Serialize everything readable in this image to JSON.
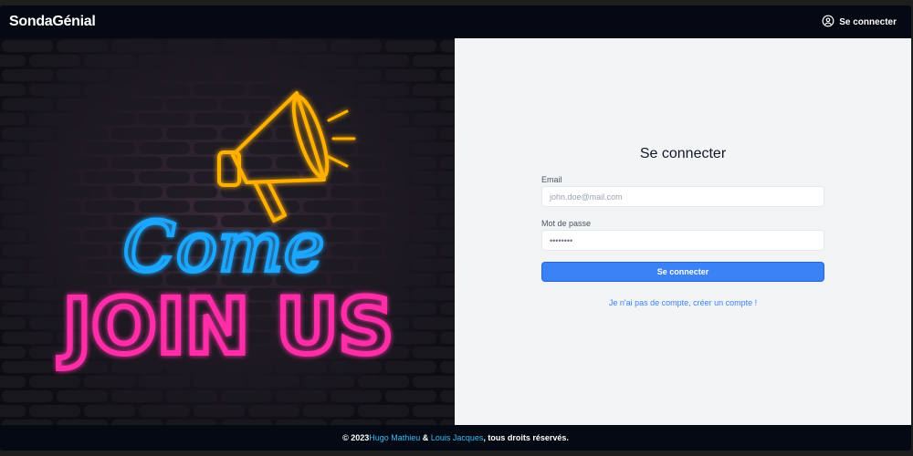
{
  "navbar": {
    "brand": "SondaGénial",
    "login_label": "Se connecter"
  },
  "hero": {
    "line1": "Come",
    "line2": "JOIN US",
    "colors": {
      "blue": "#1ea7ff",
      "pink": "#ff2ea8",
      "yellow": "#ffb000"
    }
  },
  "form": {
    "title": "Se connecter",
    "email_label": "Email",
    "email_placeholder": "john.doe@mail.com",
    "password_label": "Mot de passe",
    "password_value": "••••••••",
    "submit_label": "Se connecter",
    "signup_link": "Je n'ai pas de compte, créer un compte !"
  },
  "footer": {
    "prefix": "© 2023 ",
    "author1": "Hugo Mathieu",
    "amp": " & ",
    "author2": "Louis Jacques",
    "suffix": ", tous droits réservés."
  }
}
